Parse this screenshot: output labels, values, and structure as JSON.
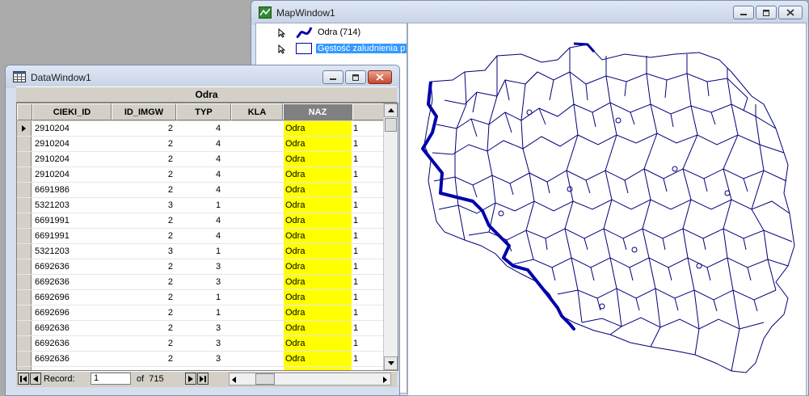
{
  "map_window": {
    "title": "MapWindow1",
    "layers": [
      {
        "label": "Odra (714)",
        "selected": false,
        "symbol": "river-line",
        "color": "#0000aa"
      },
      {
        "label": "Gęstość zaludnienia p",
        "selected": true,
        "symbol": "polygon-outline",
        "color": "#0000aa"
      }
    ]
  },
  "data_window": {
    "title": "DataWindow1",
    "table_title": "Odra",
    "columns": [
      "CIEKI_ID",
      "ID_IMGW",
      "TYP",
      "KLA",
      "NAZ"
    ],
    "rows": [
      {
        "cieki_id": "2910204",
        "typ": "2",
        "kla": "4",
        "naz": "Odra",
        "extra": "1"
      },
      {
        "cieki_id": "2910204",
        "typ": "2",
        "kla": "4",
        "naz": "Odra",
        "extra": "1"
      },
      {
        "cieki_id": "2910204",
        "typ": "2",
        "kla": "4",
        "naz": "Odra",
        "extra": "1"
      },
      {
        "cieki_id": "2910204",
        "typ": "2",
        "kla": "4",
        "naz": "Odra",
        "extra": "1"
      },
      {
        "cieki_id": "6691986",
        "typ": "2",
        "kla": "4",
        "naz": "Odra",
        "extra": "1"
      },
      {
        "cieki_id": "5321203",
        "typ": "3",
        "kla": "1",
        "naz": "Odra",
        "extra": "1"
      },
      {
        "cieki_id": "6691991",
        "typ": "2",
        "kla": "4",
        "naz": "Odra",
        "extra": "1"
      },
      {
        "cieki_id": "6691991",
        "typ": "2",
        "kla": "4",
        "naz": "Odra",
        "extra": "1"
      },
      {
        "cieki_id": "5321203",
        "typ": "3",
        "kla": "1",
        "naz": "Odra",
        "extra": "1"
      },
      {
        "cieki_id": "6692636",
        "typ": "2",
        "kla": "3",
        "naz": "Odra",
        "extra": "1"
      },
      {
        "cieki_id": "6692636",
        "typ": "2",
        "kla": "3",
        "naz": "Odra",
        "extra": "1"
      },
      {
        "cieki_id": "6692696",
        "typ": "2",
        "kla": "1",
        "naz": "Odra",
        "extra": "1"
      },
      {
        "cieki_id": "6692696",
        "typ": "2",
        "kla": "1",
        "naz": "Odra",
        "extra": "1"
      },
      {
        "cieki_id": "6692636",
        "typ": "2",
        "kla": "3",
        "naz": "Odra",
        "extra": "1"
      },
      {
        "cieki_id": "6692636",
        "typ": "2",
        "kla": "3",
        "naz": "Odra",
        "extra": "1"
      },
      {
        "cieki_id": "6692636",
        "typ": "2",
        "kla": "3",
        "naz": "Odra",
        "extra": "1"
      },
      {
        "cieki_id": "6692636",
        "typ": "2",
        "kla": "3",
        "naz": "Odra",
        "extra": "1"
      }
    ],
    "nav": {
      "record_label": "Record:",
      "record_value": "1",
      "of_label": "of  715"
    },
    "highlight_color": "#ffff00"
  }
}
